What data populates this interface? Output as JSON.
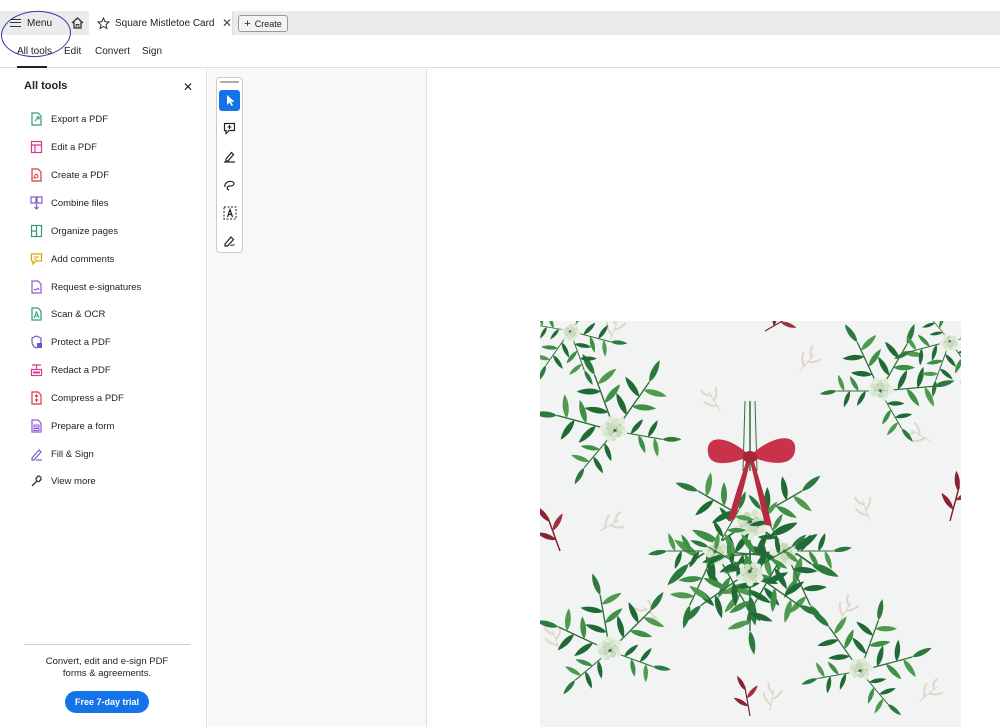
{
  "tabbar": {
    "menu_label": "Menu",
    "doc_tab_title": "Square Mistletoe Cards ...",
    "create_label": "Create"
  },
  "toolbar": {
    "items": [
      "All tools",
      "Edit",
      "Convert",
      "Sign"
    ]
  },
  "left_panel": {
    "title": "All tools",
    "tools": [
      {
        "label": "Export a PDF",
        "icon": "export-pdf-icon",
        "color": "#2d9d78"
      },
      {
        "label": "Edit a PDF",
        "icon": "edit-pdf-icon",
        "color": "#d83790"
      },
      {
        "label": "Create a PDF",
        "icon": "create-pdf-icon",
        "color": "#d7373f"
      },
      {
        "label": "Combine files",
        "icon": "combine-files-icon",
        "color": "#7c5ad3"
      },
      {
        "label": "Organize pages",
        "icon": "organize-pages-icon",
        "color": "#2d9d78"
      },
      {
        "label": "Add comments",
        "icon": "add-comments-icon",
        "color": "#d9a400"
      },
      {
        "label": "Request e-signatures",
        "icon": "request-esignatures-icon",
        "color": "#9256d9"
      },
      {
        "label": "Scan & OCR",
        "icon": "scan-ocr-icon",
        "color": "#2d9d78"
      },
      {
        "label": "Protect a PDF",
        "icon": "protect-pdf-icon",
        "color": "#6a56c9"
      },
      {
        "label": "Redact a PDF",
        "icon": "redact-pdf-icon",
        "color": "#d83790"
      },
      {
        "label": "Compress a PDF",
        "icon": "compress-pdf-icon",
        "color": "#d7373f"
      },
      {
        "label": "Prepare a form",
        "icon": "prepare-form-icon",
        "color": "#9256d9"
      },
      {
        "label": "Fill & Sign",
        "icon": "fill-sign-icon",
        "color": "#7c5ad3"
      },
      {
        "label": "View more",
        "icon": "view-more-icon",
        "color": "#333333"
      }
    ],
    "promo_line1": "Convert, edit and e-sign PDF",
    "promo_line2": "forms & agreements.",
    "trial_button": "Free 7-day trial"
  },
  "vertical_tools": [
    {
      "icon": "select-cursor-icon",
      "active": true
    },
    {
      "icon": "add-comment-icon",
      "active": false
    },
    {
      "icon": "highlight-pen-icon",
      "active": false
    },
    {
      "icon": "draw-freehand-icon",
      "active": false
    },
    {
      "icon": "text-select-icon",
      "active": false
    },
    {
      "icon": "fill-sign-icon",
      "active": false
    }
  ],
  "colors": {
    "accent": "#1473e6",
    "bow": "#c8324a"
  }
}
